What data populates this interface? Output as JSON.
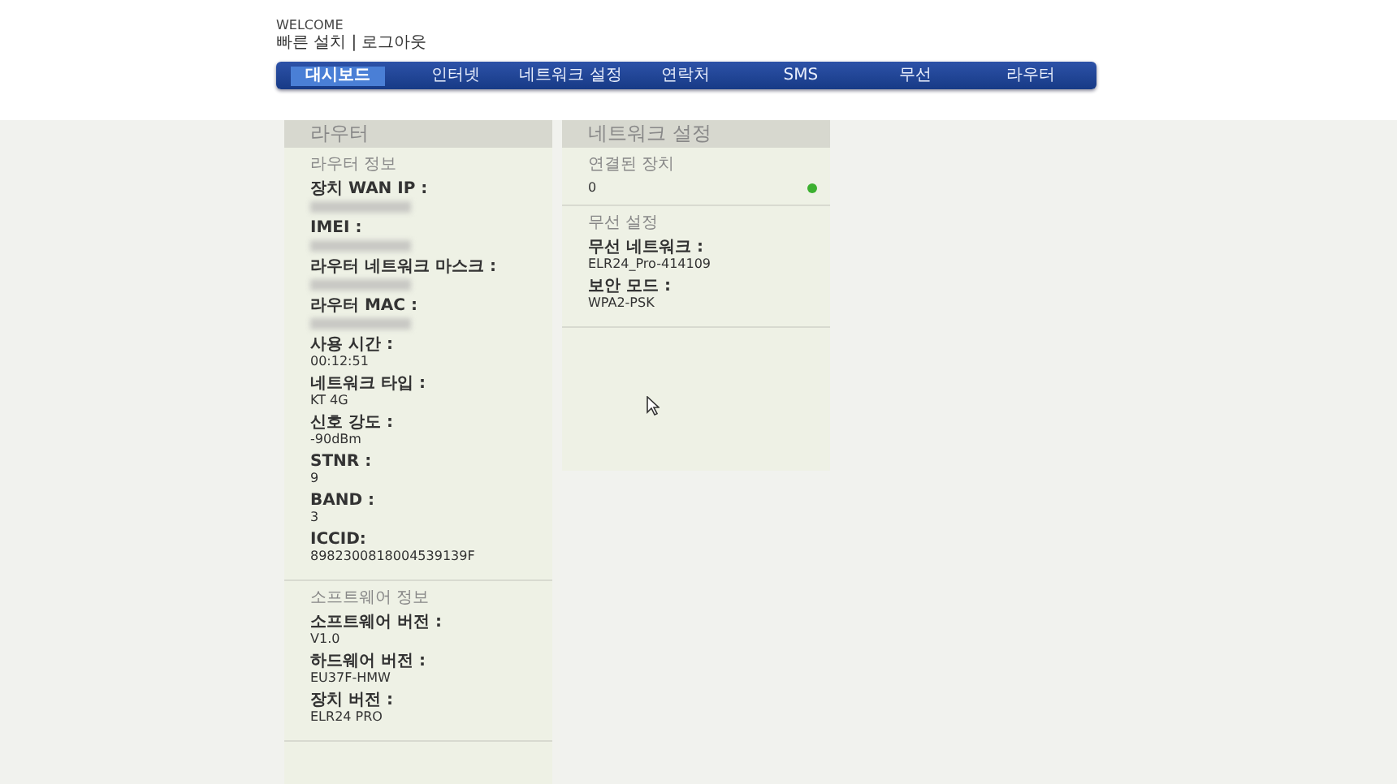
{
  "header": {
    "welcome": "WELCOME",
    "links": [
      {
        "label": "빠른 설치"
      },
      {
        "label": "로그아웃"
      }
    ],
    "separator": "|"
  },
  "nav": [
    {
      "label": "대시보드",
      "selected": true
    },
    {
      "label": "인터넷",
      "selected": false
    },
    {
      "label": "네트워크 설정",
      "selected": false
    },
    {
      "label": "연락처",
      "selected": false
    },
    {
      "label": "SMS",
      "selected": false
    },
    {
      "label": "무선",
      "selected": false
    },
    {
      "label": "라우터",
      "selected": false
    }
  ],
  "router_panel": {
    "title": "라우터",
    "sections": [
      {
        "title": "라우터 정보",
        "fields": [
          {
            "label": "장치 WAN IP :",
            "redacted": true
          },
          {
            "label": "IMEI :",
            "redacted": true
          },
          {
            "label": "라우터 네트워크 마스크 :",
            "redacted": true
          },
          {
            "label": "라우터 MAC :",
            "redacted": true
          },
          {
            "label": "사용 시간 :",
            "value": "00:12:51",
            "redacted": false
          },
          {
            "label": "네트워크 타입 :",
            "value": "KT 4G",
            "redacted": false
          },
          {
            "label": "신호 강도 :",
            "value": "-90dBm",
            "redacted": false
          },
          {
            "label": "STNR :",
            "value": "9",
            "redacted": false
          },
          {
            "label": "BAND :",
            "value": "3",
            "redacted": false
          },
          {
            "label": "ICCID:",
            "value": "8982300818004539139F",
            "redacted": false
          }
        ]
      },
      {
        "title": "소프트웨어 정보",
        "fields": [
          {
            "label": "소프트웨어 버전 :",
            "value": "V1.0",
            "redacted": false
          },
          {
            "label": "하드웨어 버전 :",
            "value": "EU37F-HMW",
            "redacted": false
          },
          {
            "label": "장치 버전 :",
            "value": "ELR24 PRO",
            "redacted": false
          }
        ]
      }
    ]
  },
  "network_panel": {
    "title": "네트워크 설정",
    "connected": {
      "title": "연결된 장치",
      "count": "0",
      "online": true
    },
    "sections": [
      {
        "title": "무선 설정",
        "fields": [
          {
            "label": "무선 네트워크 :",
            "value": "ELR24_Pro-414109",
            "redacted": false
          },
          {
            "label": "보안 모드 :",
            "value": "WPA2-PSK",
            "redacted": false
          }
        ]
      }
    ]
  }
}
